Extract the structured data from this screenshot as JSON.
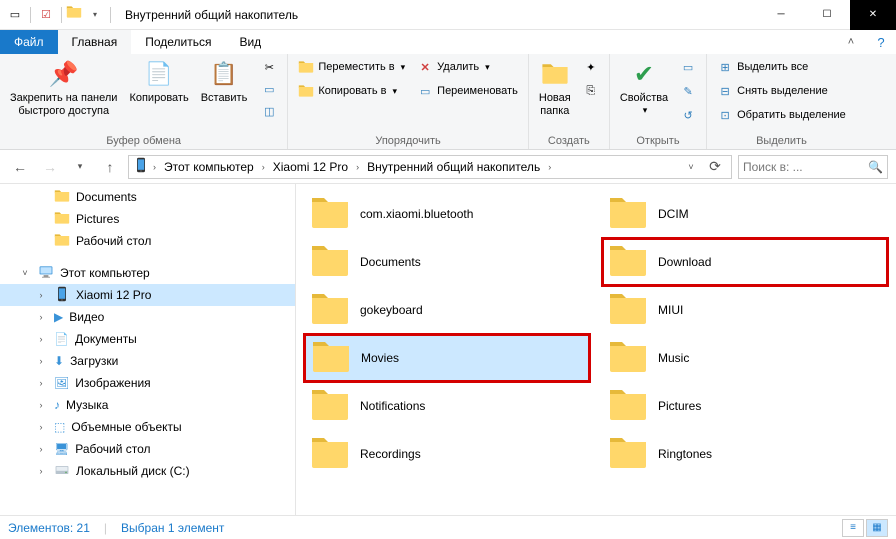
{
  "window": {
    "title": "Внутренний общий накопитель"
  },
  "tabs": {
    "file": "Файл",
    "home": "Главная",
    "share": "Поделиться",
    "view": "Вид"
  },
  "ribbon": {
    "clipboard": {
      "pin": "Закрепить на панели\nбыстрого доступа",
      "copy": "Копировать",
      "paste": "Вставить",
      "group": "Буфер обмена"
    },
    "organize": {
      "move": "Переместить в",
      "copy_to": "Копировать в",
      "delete": "Удалить",
      "rename": "Переименовать",
      "group": "Упорядочить"
    },
    "new": {
      "folder": "Новая\nпапка",
      "group": "Создать"
    },
    "open": {
      "properties": "Свойства",
      "group": "Открыть"
    },
    "select": {
      "all": "Выделить все",
      "none": "Снять выделение",
      "invert": "Обратить выделение",
      "group": "Выделить"
    }
  },
  "breadcrumb": [
    "Этот компьютер",
    "Xiaomi 12 Pro",
    "Внутренний общий накопитель"
  ],
  "search_placeholder": "Поиск в: ...",
  "nav": {
    "documents": "Documents",
    "pictures": "Pictures",
    "desktop": "Рабочий стол",
    "this_pc": "Этот компьютер",
    "xiaomi": "Xiaomi 12 Pro",
    "video": "Видео",
    "docs_ru": "Документы",
    "downloads": "Загрузки",
    "images": "Изображения",
    "music": "Музыка",
    "objects3d": "Объемные объекты",
    "desktop_ru": "Рабочий стол",
    "local_c": "Локальный диск (C:)"
  },
  "files": [
    {
      "name": "com.xiaomi.bluetooth",
      "selected": false,
      "highlight": false
    },
    {
      "name": "DCIM",
      "selected": false,
      "highlight": false
    },
    {
      "name": "Documents",
      "selected": false,
      "highlight": false
    },
    {
      "name": "Download",
      "selected": false,
      "highlight": true
    },
    {
      "name": "gokeyboard",
      "selected": false,
      "highlight": false
    },
    {
      "name": "MIUI",
      "selected": false,
      "highlight": false
    },
    {
      "name": "Movies",
      "selected": true,
      "highlight": true
    },
    {
      "name": "Music",
      "selected": false,
      "highlight": false
    },
    {
      "name": "Notifications",
      "selected": false,
      "highlight": false
    },
    {
      "name": "Pictures",
      "selected": false,
      "highlight": false
    },
    {
      "name": "Recordings",
      "selected": false,
      "highlight": false
    },
    {
      "name": "Ringtones",
      "selected": false,
      "highlight": false
    }
  ],
  "status": {
    "count_label": "Элементов: 21",
    "sel_label": "Выбран 1 элемент"
  }
}
